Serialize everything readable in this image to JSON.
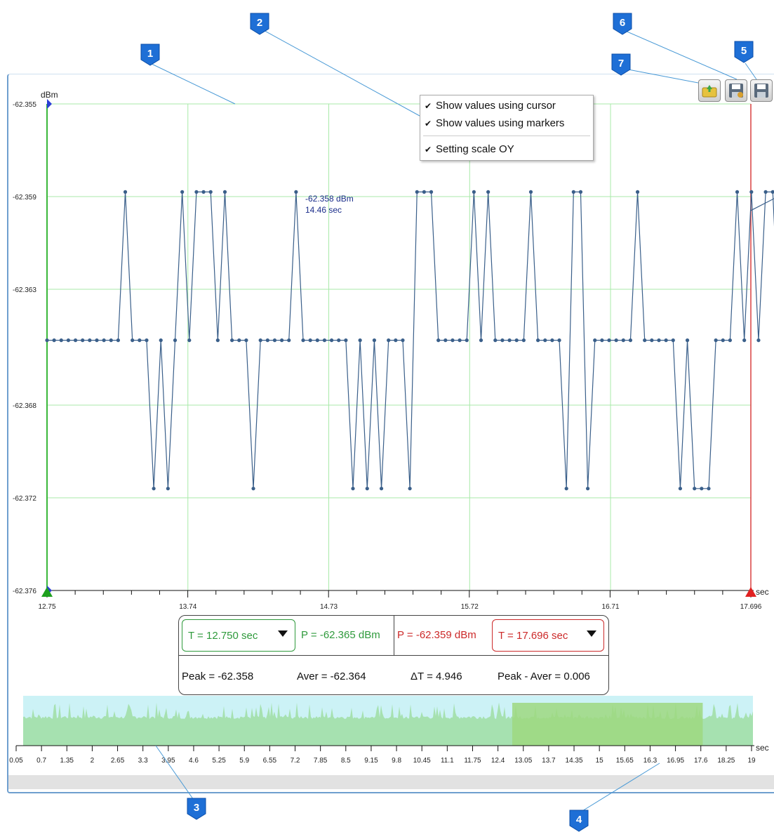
{
  "badges": [
    "1",
    "2",
    "3",
    "4",
    "5",
    "6",
    "7"
  ],
  "context_menu": {
    "items": [
      {
        "label": "Show values using cursor",
        "checked": true
      },
      {
        "label": "Show values using markers",
        "checked": true
      },
      {
        "label": "Setting scale OY",
        "checked": true
      }
    ]
  },
  "toolbar": {
    "icons": [
      "load-icon",
      "save-as-icon",
      "save-icon"
    ]
  },
  "chart_data": {
    "type": "line",
    "y_unit": "dBm",
    "x_unit": "sec",
    "y_ticks": [
      "-62.355",
      "-62.359",
      "-62.363",
      "-62.368",
      "-62.372",
      "-62.376"
    ],
    "y_tick_values": [
      -62.355,
      -62.359,
      -62.363,
      -62.368,
      -62.372,
      -62.376
    ],
    "x_tick_labels": [
      "12.75",
      "13.74",
      "14.73",
      "15.72",
      "16.71",
      "17.696"
    ],
    "x_tick_values": [
      12.75,
      13.74,
      14.73,
      15.72,
      16.71,
      17.696
    ],
    "xlim": [
      12.75,
      17.696
    ],
    "ylim": [
      -62.376,
      -62.355
    ],
    "grid": true,
    "series_color": "#3a5f8a",
    "grid_color": "#a8eaa8",
    "cursor_readout": {
      "value": "-62.358 dBm",
      "time": "14.46 sec"
    },
    "x_start": 12.75,
    "x_step": 0.05,
    "levels": {
      "H": -62.3588,
      "M": -62.3652,
      "L": -62.3716
    },
    "sequence": "MMMMMMMMMMMHMMMLMLMHMHHHMHMMMLMMMMMHMMMMMMMLMLMLMMMLHHHMMMMMHMHMMMMMHMMMMLHHLMMMMMMHMMMMMLMLLLMMMHMHMHHMH"
  },
  "stats": {
    "left_cursor": "T = 12.750 sec",
    "left_power": "P = -62.365 dBm",
    "right_power": "P = -62.359 dBm",
    "right_cursor": "T = 17.696 sec",
    "peak": "Peak = -62.358",
    "aver": "Aver = -62.364",
    "delta_t": "ΔT = 4.946",
    "peak_aver": "Peak - Aver = 0.006"
  },
  "overview": {
    "x_unit": "sec",
    "tick_labels": [
      "0.05",
      "0.7",
      "1.35",
      "2",
      "2.65",
      "3.3",
      "3.95",
      "4.6",
      "5.25",
      "5.9",
      "6.55",
      "7.2",
      "7.85",
      "8.5",
      "9.15",
      "9.8",
      "10.45",
      "11.1",
      "11.75",
      "12.4",
      "13.05",
      "13.7",
      "14.35",
      "15",
      "15.65",
      "16.3",
      "16.95",
      "17.6",
      "18.25",
      "19"
    ],
    "xlim": [
      0.05,
      19
    ],
    "selection": [
      12.75,
      17.696
    ],
    "colors": {
      "background": "#ccf2f6",
      "fill": "#a6e1b0",
      "selection": "#9ed880"
    }
  }
}
